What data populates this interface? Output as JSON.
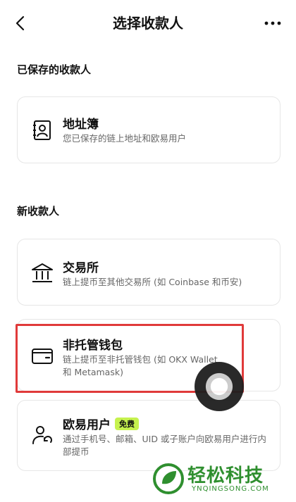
{
  "header": {
    "title": "选择收款人"
  },
  "saved": {
    "label": "已保存的收款人",
    "address_book": {
      "name": "地址簿",
      "desc": "您已保存的链上地址和欧易用户"
    }
  },
  "new": {
    "label": "新收款人",
    "exchange": {
      "name": "交易所",
      "desc": "链上提币至其他交易所 (如 Coinbase 和币安)"
    },
    "wallet": {
      "name": "非托管钱包",
      "desc": "链上提币至非托管钱包 (如 OKX Wallet 和 Metamask)"
    },
    "okx_user": {
      "name": "欧易用户",
      "badge": "免费",
      "desc": "通过手机号、邮箱、UID 或子账户向欧易用户进行内部提币"
    }
  },
  "watermark": {
    "text": "轻松科技",
    "sub": "YNQINGSONG.COM"
  },
  "colors": {
    "highlight": "#e03a3a",
    "badge": "#c6f24e",
    "watermark": "#2f8f2f"
  }
}
